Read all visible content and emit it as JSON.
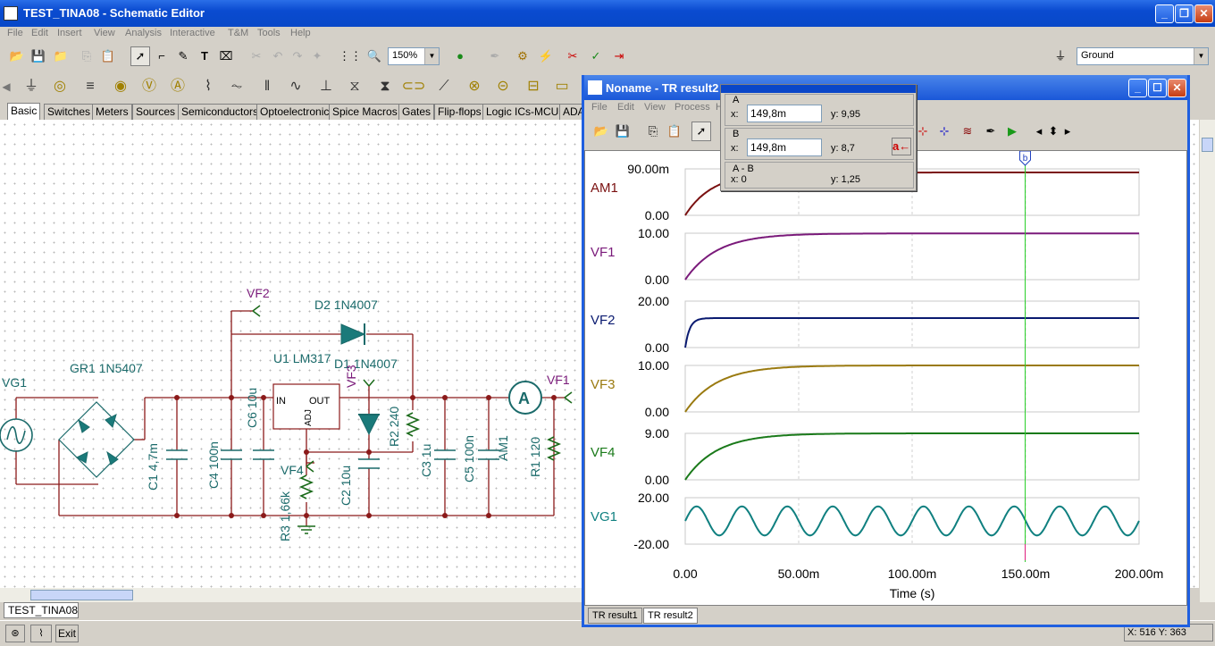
{
  "app": {
    "title": "TEST_TINA08 - Schematic Editor"
  },
  "menu": [
    "File",
    "Edit",
    "Insert",
    "View",
    "Analysis",
    "Interactive",
    "T&M",
    "Tools",
    "Help"
  ],
  "toolbar": {
    "zoom": "150%",
    "ground_select": "Ground"
  },
  "component_tabs": [
    "Basic",
    "Switches",
    "Meters",
    "Sources",
    "Semiconductors",
    "Optoelectronic",
    "Spice Macros",
    "Gates",
    "Flip-flops",
    "Logic ICs-MCUs",
    "ADA"
  ],
  "schematic": {
    "labels": {
      "vg1": "VG1",
      "gr1": "GR1 1N5407",
      "vf2": "VF2",
      "d2": "D2 1N4007",
      "u1": "U1 LM317",
      "d1": "D1 1N4007",
      "vf3": "VF3",
      "vf1": "VF1",
      "c1": "C1 4,7m",
      "c4": "C4 100n",
      "c6": "C6 10u",
      "vf4": "VF4",
      "r3": "R3 1,66k",
      "c2": "C2 10u",
      "r2": "R2 240",
      "c3": "C3 1u",
      "c5": "C5 100n",
      "am1": "AM1",
      "r1": "R1 120",
      "in": "IN",
      "out": "OUT",
      "adj": "ADJ",
      "ammeter": "A"
    }
  },
  "document_tab": "TEST_TINA08",
  "status": {
    "exit": "Exit",
    "coords": "X: 516  Y: 363"
  },
  "result_window": {
    "title": "Noname - TR result2",
    "menu": [
      "File",
      "Edit",
      "View",
      "Process",
      "H"
    ],
    "tabs": [
      "TR result1",
      "TR result2"
    ],
    "cursor_panel": {
      "a": {
        "label": "A",
        "x_label": "x:",
        "x_value": "149,8m",
        "y_label": "y: 9,95"
      },
      "b": {
        "label": "B",
        "x_label": "x:",
        "x_value": "149,8m",
        "y_label": "y: 8,7"
      },
      "diff": {
        "label": "A - B",
        "x_text": "x:  0",
        "y_text": "y: 1,25"
      }
    }
  },
  "chart_data": {
    "type": "line",
    "xlabel": "Time (s)",
    "x_ticks": [
      "0.00",
      "50.00m",
      "100.00m",
      "150.00m",
      "200.00m"
    ],
    "x_range": [
      0,
      0.2
    ],
    "cursor_x": 0.1498,
    "cursor_label": "b",
    "grid": true,
    "series": [
      {
        "name": "AM1",
        "ymax_label": "90.00m",
        "ymin_label": "0.00",
        "ylim": [
          0,
          0.09
        ],
        "color": "#7a1010",
        "tau": 0.012,
        "final": 0.083,
        "kind": "exp"
      },
      {
        "name": "VF1",
        "ymax_label": "10.00",
        "ymin_label": "0.00",
        "ylim": [
          0,
          10
        ],
        "color": "#7a1a7a",
        "tau": 0.014,
        "final": 9.95,
        "kind": "exp"
      },
      {
        "name": "VF2",
        "ymax_label": "20.00",
        "ymin_label": "0.00",
        "ylim": [
          0,
          20
        ],
        "color": "#0a1a70",
        "tau": 0.002,
        "final": 12.7,
        "kind": "exp"
      },
      {
        "name": "VF3",
        "ymax_label": "10.00",
        "ymin_label": "0.00",
        "ylim": [
          0,
          10
        ],
        "color": "#9a7a10",
        "tau": 0.014,
        "final": 10.0,
        "kind": "exp"
      },
      {
        "name": "VF4",
        "ymax_label": "9.00",
        "ymin_label": "0.00",
        "ylim": [
          0,
          9
        ],
        "color": "#1a7a1a",
        "tau": 0.014,
        "final": 9.0,
        "kind": "exp"
      },
      {
        "name": "VG1",
        "ymax_label": "20.00",
        "ymin_label": "-20.00",
        "ylim": [
          -20,
          20
        ],
        "color": "#108080",
        "amp": 12.5,
        "freq": 50,
        "kind": "sine"
      }
    ]
  }
}
